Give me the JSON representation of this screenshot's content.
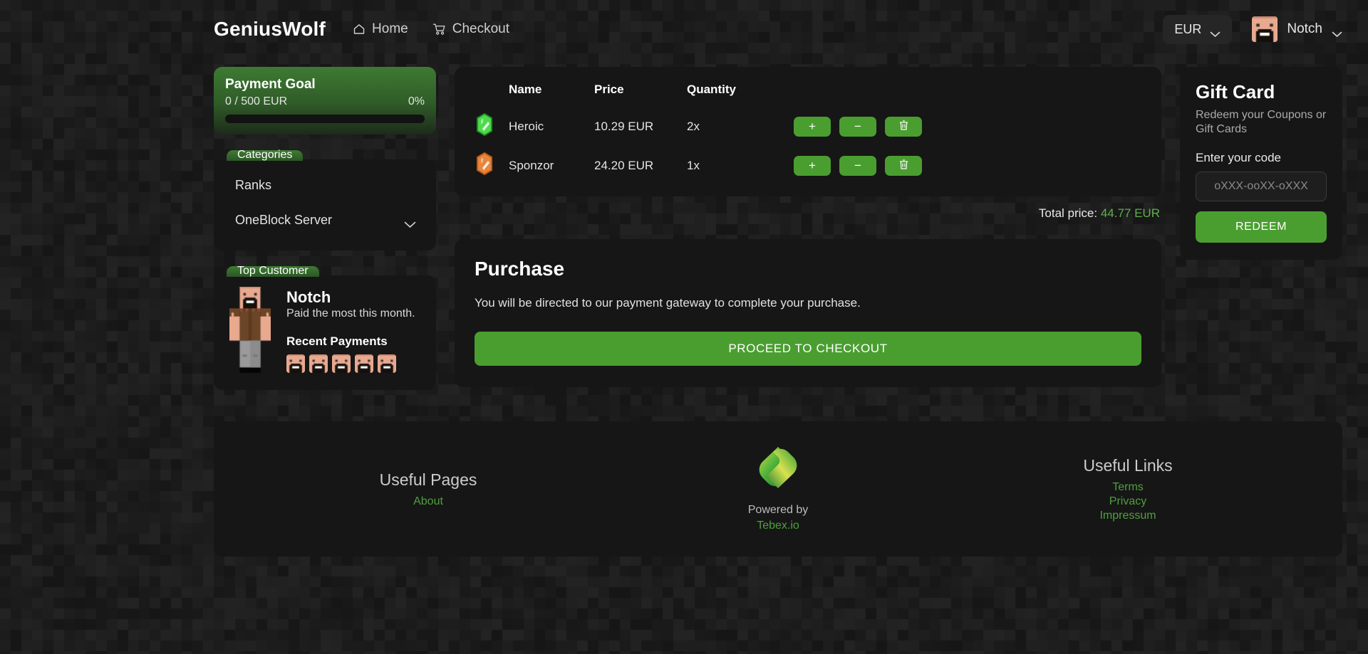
{
  "header": {
    "brand": "GeniusWolf",
    "nav": [
      {
        "label": "Home",
        "icon": "home-icon"
      },
      {
        "label": "Checkout",
        "icon": "cart-icon"
      }
    ],
    "currency": {
      "value": "EUR",
      "icon": "chevron-down-icon"
    },
    "user": {
      "name": "Notch",
      "avatar": "notch-avatar",
      "icon": "chevron-down-icon"
    }
  },
  "payment_goal": {
    "title": "Payment Goal",
    "progress_text": "0 / 500 EUR",
    "percent_label": "0%",
    "percent_value": 0
  },
  "categories": {
    "chip_label": "Categories",
    "items": [
      {
        "label": "Ranks",
        "has_chevron": false
      },
      {
        "label": "OneBlock Server",
        "has_chevron": true
      }
    ]
  },
  "top_customer": {
    "chip_label": "Top Customer",
    "name": "Notch",
    "subtitle": "Paid the most this month.",
    "recent_payments_title": "Recent Payments",
    "recent_payment_count": 5
  },
  "cart": {
    "columns": [
      "Name",
      "Price",
      "Quantity"
    ],
    "rows": [
      {
        "icon": "gem-icon-green",
        "icon_color": "#4ddb4d",
        "name": "Heroic",
        "price": "10.29 EUR",
        "quantity": "2x",
        "add_label": "+",
        "remove_label": "−",
        "delete_icon": "trash-icon"
      },
      {
        "icon": "gem-icon-orange",
        "icon_color": "#e8853c",
        "name": "Sponzor",
        "price": "24.20 EUR",
        "quantity": "1x",
        "add_label": "+",
        "remove_label": "−",
        "delete_icon": "trash-icon"
      }
    ],
    "total_label": "Total price:",
    "total_value": "44.77 EUR"
  },
  "purchase": {
    "title": "Purchase",
    "description": "You will be directed to our payment gateway to complete your purchase.",
    "button_label": "PROCEED TO CHECKOUT"
  },
  "gift_card": {
    "title": "Gift Card",
    "subtitle": "Redeem your Coupons or Gift Cards",
    "field_label": "Enter your code",
    "input_value": "",
    "input_placeholder": "oXXX-ooXX-oXXX",
    "button_label": "REDEEM"
  },
  "footer": {
    "left": {
      "heading": "Useful Pages",
      "links": [
        "About"
      ]
    },
    "center": {
      "logo": "tebex-logo",
      "powered_by": "Powered by",
      "brand": "Tebex.io"
    },
    "right": {
      "heading": "Useful Links",
      "links": [
        "Terms",
        "Privacy",
        "Impressum"
      ]
    }
  },
  "colors": {
    "accent_green": "#4a9e30",
    "link_green": "#4fa03c",
    "total_green": "#5db04a",
    "panel_bg": "#161616",
    "page_bg": "#1a1a1a"
  }
}
